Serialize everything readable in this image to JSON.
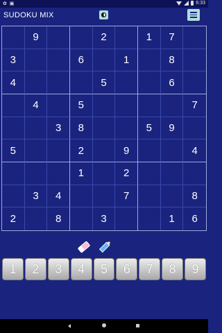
{
  "status": {
    "right_text": "6:33"
  },
  "app": {
    "title": "SUDOKU MIX"
  },
  "icons": {
    "theme": "contrast-icon",
    "menu": "hamburger-menu-icon",
    "eraser": "eraser-icon",
    "pencil": "pencil-icon"
  },
  "board": {
    "rows": [
      [
        "",
        "9",
        "",
        "",
        "2",
        "",
        "1",
        "7",
        ""
      ],
      [
        "3",
        "",
        "",
        "6",
        "",
        "1",
        "",
        "8",
        ""
      ],
      [
        "4",
        "",
        "",
        "",
        "5",
        "",
        "",
        "6",
        ""
      ],
      [
        "",
        "4",
        "",
        "5",
        "",
        "",
        "",
        "",
        "7"
      ],
      [
        "",
        "",
        "3",
        "8",
        "",
        "",
        "5",
        "9",
        ""
      ],
      [
        "5",
        "",
        "",
        "2",
        "",
        "9",
        "",
        "",
        "4"
      ],
      [
        "",
        "",
        "",
        "1",
        "",
        "2",
        "",
        "",
        ""
      ],
      [
        "",
        "3",
        "4",
        "",
        "",
        "7",
        "",
        "",
        "8"
      ],
      [
        "2",
        "",
        "8",
        "",
        "3",
        "",
        "",
        "1",
        "6"
      ]
    ]
  },
  "keypad": [
    "1",
    "2",
    "3",
    "4",
    "5",
    "6",
    "7",
    "8",
    "9"
  ],
  "colors": {
    "background": "#1a237e",
    "accent": "#b2dfdb",
    "grid_major": "#9fa8da",
    "grid_minor": "#3949ab"
  }
}
